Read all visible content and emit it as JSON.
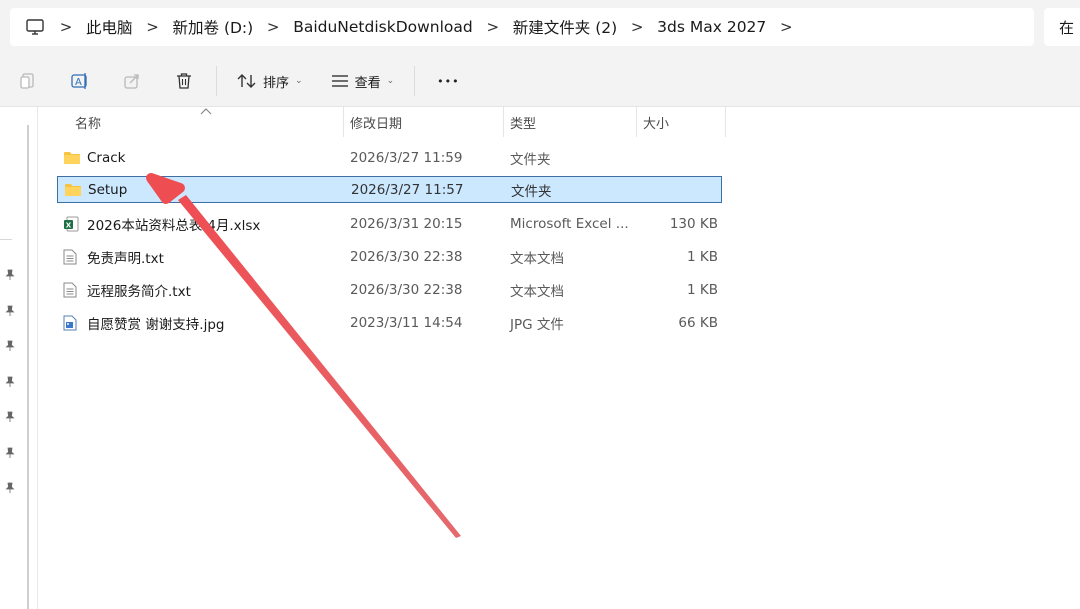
{
  "breadcrumb": {
    "items": [
      "此电脑",
      "新加卷 (D:)",
      "BaiduNetdiskDownload",
      "新建文件夹 (2)",
      "3ds Max 2027"
    ],
    "separator": ">"
  },
  "search": {
    "label": "在"
  },
  "toolbar": {
    "sort_label": "排序",
    "view_label": "查看",
    "more_label": "•••"
  },
  "columns": {
    "name": "名称",
    "date": "修改日期",
    "type": "类型",
    "size": "大小"
  },
  "files": [
    {
      "name": "Crack",
      "date": "2026/3/27 11:59",
      "type": "文件夹",
      "size": "",
      "icon": "folder-icon",
      "selected": false
    },
    {
      "name": "Setup",
      "date": "2026/3/27 11:57",
      "type": "文件夹",
      "size": "",
      "icon": "folder-icon",
      "selected": true
    },
    {
      "name": "2026本站资料总表-4月.xlsx",
      "date": "2026/3/31 20:15",
      "type": "Microsoft Excel ...",
      "size": "130 KB",
      "icon": "excel-file-icon",
      "selected": false
    },
    {
      "name": "免责声明.txt",
      "date": "2026/3/30 22:38",
      "type": "文本文档",
      "size": "1 KB",
      "icon": "text-file-icon",
      "selected": false
    },
    {
      "name": "远程服务简介.txt",
      "date": "2026/3/30 22:38",
      "type": "文本文档",
      "size": "1 KB",
      "icon": "text-file-icon",
      "selected": false
    },
    {
      "name": "自愿赞赏 谢谢支持.jpg",
      "date": "2023/3/11 14:54",
      "type": "JPG 文件",
      "size": "66 KB",
      "icon": "image-file-icon",
      "selected": false
    }
  ],
  "colors": {
    "selection_bg": "#cce8ff",
    "selection_border": "#3d6fa6",
    "folder": "#f6c343",
    "annotation_arrow": "#e9545a"
  }
}
